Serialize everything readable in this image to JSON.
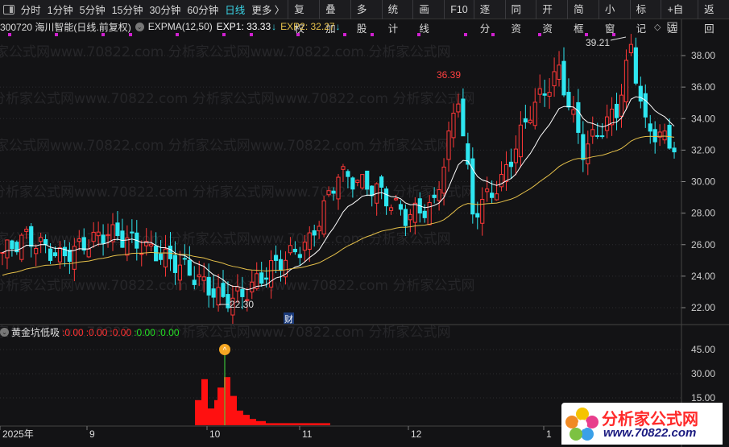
{
  "toolbar": {
    "periods": [
      "分时",
      "1分钟",
      "5分钟",
      "15分钟",
      "30分钟",
      "60分钟",
      "日线",
      "更多 〉"
    ],
    "active": "日线",
    "buttons": [
      "复权",
      "叠加",
      "多股",
      "统计",
      "画线",
      "F10",
      "逐分",
      "同资",
      "开资",
      "简框",
      "小窗",
      "标记",
      "+自选",
      "返回"
    ]
  },
  "stock": {
    "code_name": "300720 海川智能(日线.前复权)",
    "indicator": "EXPMA(12,50)",
    "exp1": "EXP1: 33.33",
    "exp2": "EXP2: 32.27",
    "arrow": "↓"
  },
  "price_axis": [
    "38.00",
    "36.00",
    "34.00",
    "32.00",
    "30.00",
    "28.00",
    "26.00",
    "24.00",
    "22.00"
  ],
  "annotations": {
    "high": "39.21",
    "mid_high": "36.39",
    "low": "22.30",
    "cai": "财"
  },
  "indicator": {
    "name": "黄金坑低吸",
    "values": [
      ":0.00",
      ":0.00",
      ":0.00",
      ":0.00",
      ":0.00"
    ],
    "axis": [
      "45.00",
      "30.00",
      "15.00"
    ]
  },
  "x_axis": [
    "2025年",
    "9",
    "10",
    "11",
    "12",
    "1"
  ],
  "logo": {
    "title": "分析家公式网",
    "url": "www.70822.com"
  },
  "colors": {
    "up": "#ff3838",
    "down": "#2ee6f0",
    "exp1": "#ffffff",
    "exp2": "#e5c04a",
    "accent": "#3ad6e8"
  },
  "chart_data": {
    "type": "candlestick",
    "ylim": [
      21.5,
      39.5
    ],
    "price_path": [
      [
        0,
        25.5
      ],
      [
        5,
        26.5
      ],
      [
        12,
        25.2
      ],
      [
        22,
        26.8
      ],
      [
        30,
        25.8
      ],
      [
        38,
        24.5
      ],
      [
        46,
        22.5
      ],
      [
        50,
        22.8
      ],
      [
        56,
        24.5
      ],
      [
        64,
        26.2
      ],
      [
        70,
        30.5
      ],
      [
        78,
        29.5
      ],
      [
        84,
        27.8
      ],
      [
        90,
        28.5
      ],
      [
        95,
        35.5
      ],
      [
        98,
        28
      ],
      [
        104,
        30
      ],
      [
        110,
        34.5
      ],
      [
        116,
        37
      ],
      [
        121,
        32
      ],
      [
        128,
        34.5
      ],
      [
        131,
        38.5
      ],
      [
        134,
        33.5
      ],
      [
        140,
        32.3
      ]
    ],
    "exp1_end": 33.33,
    "exp2_end": 32.27
  }
}
